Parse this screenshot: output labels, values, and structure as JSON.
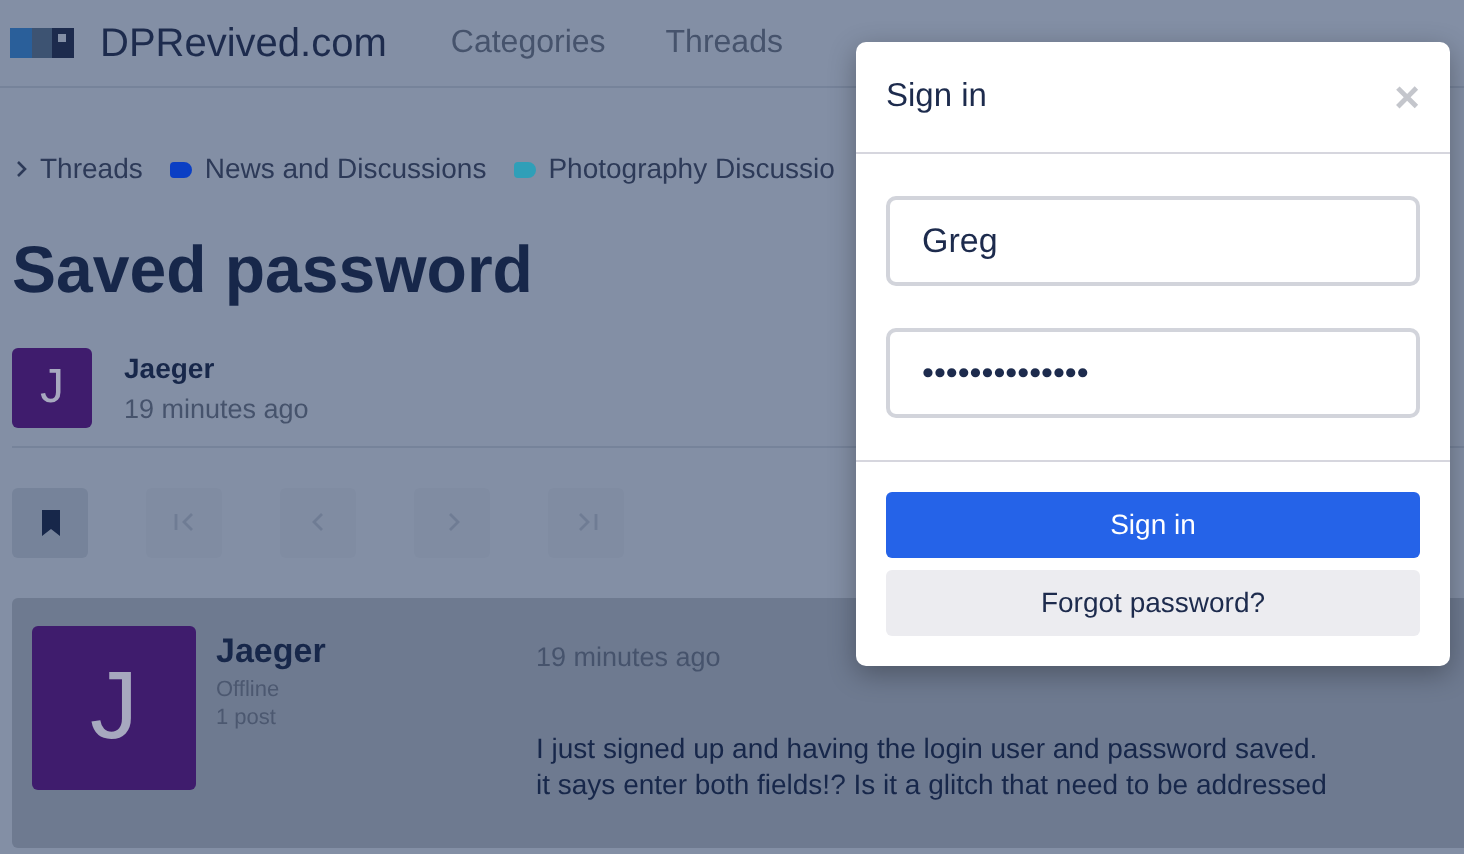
{
  "site": {
    "name": "DPRevived.com",
    "nav": [
      {
        "label": "Categories"
      },
      {
        "label": "Threads"
      }
    ]
  },
  "breadcrumbs": [
    {
      "label": "Threads",
      "kind": "chevron"
    },
    {
      "label": "News and Discussions",
      "kind": "tag",
      "color": "#0b3fc4"
    },
    {
      "label": "Photography Discussio",
      "kind": "tag",
      "color": "#2f9fb8"
    }
  ],
  "thread": {
    "title": "Saved password",
    "author": {
      "initial": "J",
      "name": "Jaeger",
      "time": "19 minutes ago"
    }
  },
  "toolbar": [
    {
      "kind": "bookmark",
      "disabled": false
    },
    {
      "kind": "first",
      "disabled": true
    },
    {
      "kind": "prev",
      "disabled": true
    },
    {
      "kind": "next",
      "disabled": true
    },
    {
      "kind": "last",
      "disabled": true
    }
  ],
  "post": {
    "author": {
      "initial": "J",
      "name": "Jaeger",
      "status": "Offline",
      "posts": "1 post"
    },
    "time": "19 minutes ago",
    "lines": [
      "I just signed up and having the login user and password saved.",
      "it says enter both fields!? Is it a glitch that need to be addressed"
    ]
  },
  "modal": {
    "title": "Sign in",
    "close": "×",
    "username": "Greg",
    "password": "••••••••••••••",
    "buttons": [
      {
        "label": "Sign in",
        "kind": "primary"
      },
      {
        "label": "Forgot password?",
        "kind": "secondary"
      }
    ]
  }
}
